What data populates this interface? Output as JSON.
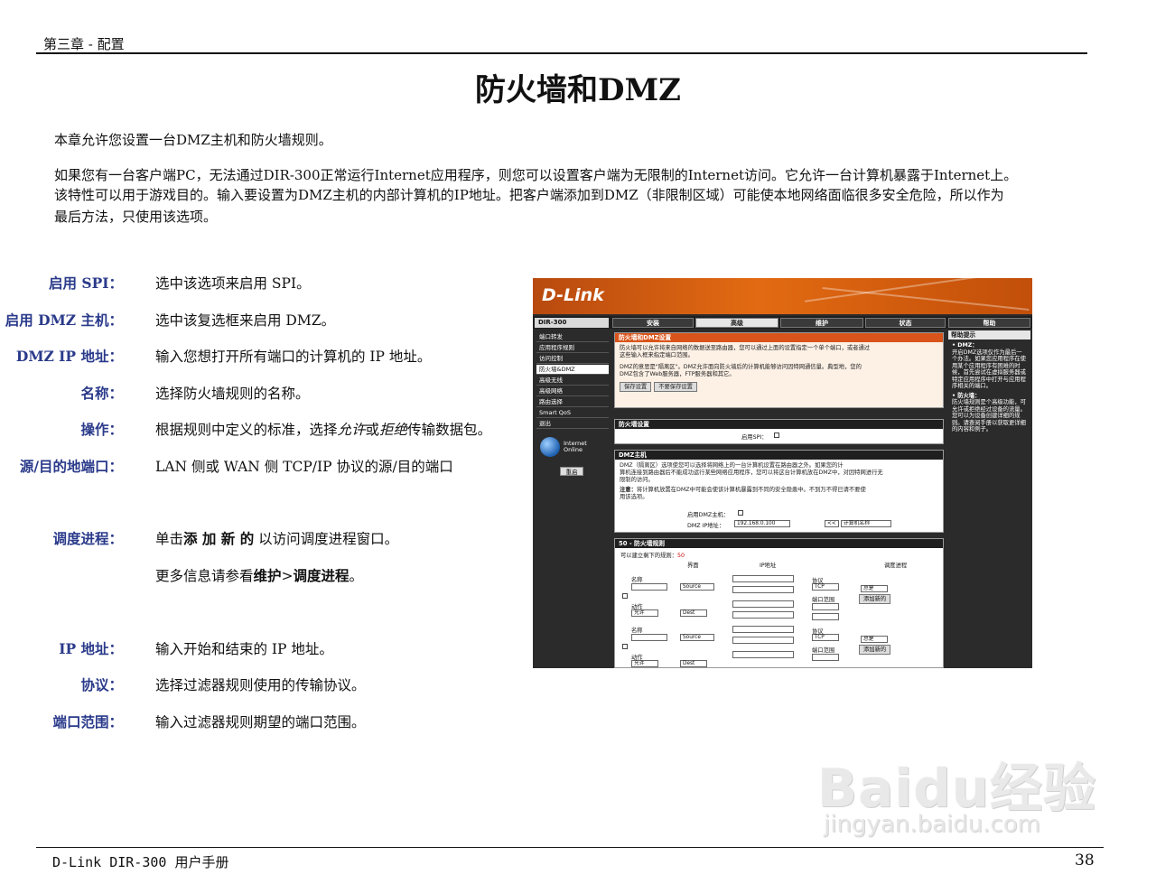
{
  "header": {
    "chapter": "第三章 - 配置"
  },
  "title": "防火墙和DMZ",
  "intro": [
    "本章允许您设置一台DMZ主机和防火墙规则。",
    "如果您有一台客户端PC，无法通过DIR-300正常运行Internet应用程序，则您可以设置客户端为无限制的Internet访问。它允许一台计算机暴露于Internet上。",
    "该特性可以用于游戏目的。输入要设置为DMZ主机的内部计算机的IP地址。把客户端添加到DMZ（非限制区域）可能使本地网络面临很多安全危险，所以作为",
    "最后方法，只使用该选项。"
  ],
  "definitions": {
    "spi": {
      "term": "启用 SPI：",
      "text": "选中该选项来启用 SPI。"
    },
    "dmz": {
      "term": "启用 DMZ 主机：",
      "text": "选中该复选框来启用 DMZ。"
    },
    "dmzip": {
      "term": "DMZ IP 地址：",
      "text": "输入您想打开所有端口的计算机的 IP 地址。"
    },
    "name": {
      "term": "名称：",
      "text": "选择防火墙规则的名称。"
    },
    "action": {
      "term": "操作：",
      "text_pre": "根据规则中定义的标准，选择",
      "text_allow": "允许",
      "text_or": "或",
      "text_deny": "拒绝",
      "text_post": "传输数据包。"
    },
    "port": {
      "term": "源/目的地端口：",
      "text": "LAN 侧或 WAN 侧 TCP/IP 协议的源/目的端口"
    },
    "schedule": {
      "term": "调度进程：",
      "text_pre": "单击",
      "text_bold": "添 加 新 的",
      "text_post": "以访问调度进程窗口。"
    },
    "more": {
      "text_pre": "更多信息请参看",
      "text_bold1": "维护",
      "text_mid": ">",
      "text_bold2": "调度进程",
      "text_post": "。"
    },
    "ip": {
      "term": "IP 地址：",
      "text": "输入开始和结束的 IP 地址。"
    },
    "protocol": {
      "term": "协议：",
      "text": "选择过滤器规则使用的传输协议。"
    },
    "portrange": {
      "term": "端口范围：",
      "text": "输入过滤器规则期望的端口范围。"
    }
  },
  "screenshot": {
    "logo": "D-Link",
    "model": "DIR-300",
    "tabs": [
      "安装",
      "高级",
      "维护",
      "状态",
      "帮助"
    ],
    "sidebar": [
      "端口转发",
      "应用程序规则",
      "访问控制",
      "防火墙&DMZ",
      "高级无线",
      "高级网络",
      "路由选择",
      "Smart QoS",
      "退出"
    ],
    "online_label_1": "Internet",
    "online_label_2": "Online",
    "restart_label": "重启",
    "panel1": {
      "title": "防火墙和DMZ设置",
      "line1": "防火墙可以允许将来自网络的数据送至路由器，您可以通过上面的设置指定一个单个端口，或者通过",
      "line2": "这些输入框来指定端口范围。",
      "line3": "DMZ的意思是\"隔离区\"。DMZ允许面向防火墙后的计算机能够访问因特网通信量。典型地，您的",
      "line4": "DMZ包含了Web服务器，FTP服务器和其它。",
      "save": "保存设置",
      "nosave": "不要保存设置"
    },
    "panel2": {
      "title": "防火墙设置",
      "spi_label": "启用SPI："
    },
    "panel3": {
      "title": "DMZ主机",
      "line1": "DMZ（隔离区）选项使您可以选择将网络上的一台计算机设置在路由器之外。如果您的计",
      "line2": "算机连接到路由器后不能成功运行某些网络应用程序，您可以将这台计算机放在DMZ中，对因特网进行无",
      "line3": "限制的访问。",
      "note_bold": "注意：",
      "note": "将计算机放置在DMZ中可能会使该计算机暴露到不同的安全隐患中。不到万不得已请不要使",
      "note2": "用该选项。",
      "dmz_label": "启用DMZ主机：",
      "ip_label": "DMZ IP地址：",
      "ip_value": "192.168.0.100",
      "arrow": "<<",
      "computer": "计算机名称"
    },
    "panel4": {
      "title": "50 - 防火墙规则",
      "remaining_pre": "可以建立剩下的规则：",
      "remaining": "50",
      "cols": [
        "界面",
        "IP地址",
        "调度进程"
      ],
      "name_label": "名称",
      "action_label": "动作",
      "allow": "允许",
      "source": "Source",
      "dest": "Dest",
      "protocol_label": "协议",
      "tcp": "TCP",
      "portrange_label": "端口范围",
      "always": "总是",
      "add_new": "添加新的"
    },
    "help": {
      "title": "帮助提示",
      "p1_title": "• DMZ：",
      "p1": "开启DMZ选项仅作为最后一个办法。如果您应用程序在使用某个应用程序有困难的时候，首先尝试在虚拟服务器或特定应用程序中打开与应用程序相关的端口。",
      "p2_title": "• 防火墙：",
      "p2": "防火墙规则是个高级功能，可允许或拒绝经过设备的流量。您可以为设备创建详细的规则。请查阅手册以获取更详细的内容和例子。"
    }
  },
  "watermark": {
    "logo": "Baidu经验",
    "url": "jingyan.baidu.com"
  },
  "footer": {
    "manual": "D-Link DIR-300 用户手册",
    "page": "38"
  }
}
